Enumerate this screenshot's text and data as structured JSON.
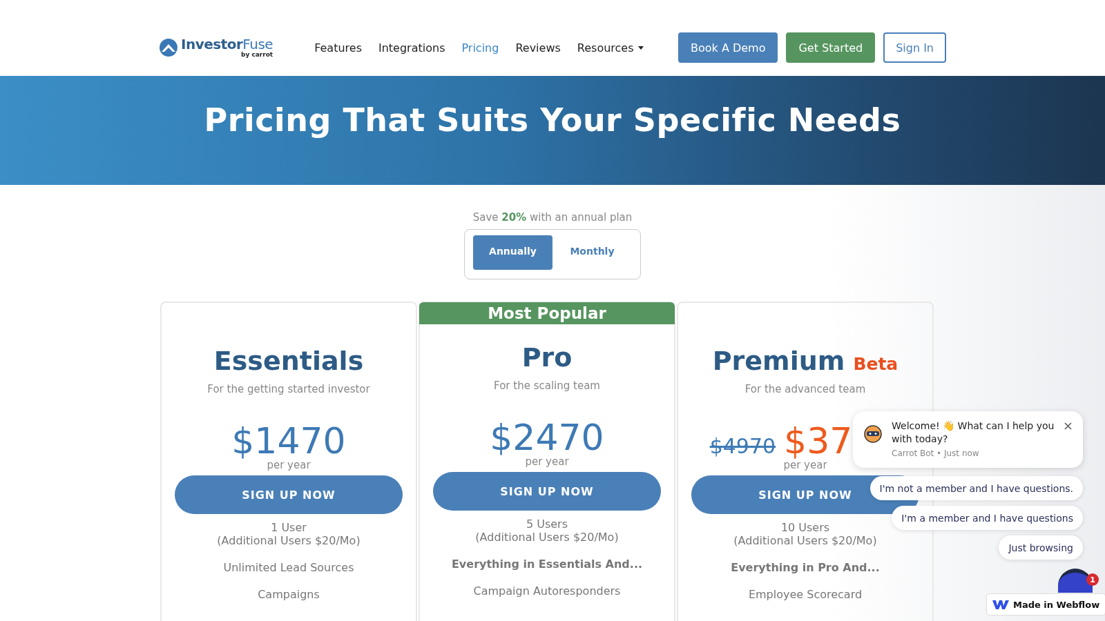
{
  "header": {
    "logo": {
      "name": "**Investor**Fuse",
      "tagline": "by carrot"
    },
    "nav": [
      {
        "label": "Features",
        "selected": false,
        "kind": "link"
      },
      {
        "label": "Integrations",
        "selected": false,
        "kind": "link"
      },
      {
        "label": "Pricing",
        "selected": true,
        "kind": "link"
      },
      {
        "label": "Reviews",
        "selected": false,
        "kind": "link"
      },
      {
        "label": "Resources",
        "selected": false,
        "kind": "dropdown"
      }
    ],
    "buttons": [
      {
        "label": "Book A Demo",
        "kind": "primary"
      },
      {
        "label": "Get Started",
        "kind": "success"
      },
      {
        "label": "Sign In",
        "kind": "outline"
      }
    ]
  },
  "hero": {
    "title": "Pricing That Suits Your Specific Needs"
  },
  "billing": {
    "note": "Save **20%** with an annual plan",
    "options": [
      {
        "label": "Annually",
        "selected": true
      },
      {
        "label": "Monthly",
        "selected": false
      }
    ]
  },
  "plans": [
    {
      "name": "Essentials",
      "popular": false,
      "subtitle": "For the getting started investor",
      "price": "$1470",
      "period": "per year",
      "cta": "SIGN UP NOW",
      "users": "1 User",
      "users_note": "(Additional Users $20/Mo)",
      "features": [
        {
          "text": "Unlimited Lead Sources",
          "bold": false
        },
        {
          "text": "Campaigns",
          "bold": false
        }
      ]
    },
    {
      "name": "Pro",
      "popular": true,
      "popular_label": "Most Popular",
      "subtitle": "For the scaling team",
      "price": "$2470",
      "period": "per year",
      "cta": "SIGN UP NOW",
      "users": "5 Users",
      "users_note": "(Additional Users $20/Mo)",
      "features": [
        {
          "text": "Everything in Essentials And...",
          "bold": true
        },
        {
          "text": "Campaign Autoresponders",
          "bold": false
        }
      ]
    },
    {
      "name": "Premium",
      "badge": "Beta",
      "popular": false,
      "subtitle": "For the advanced team",
      "old_price": "$4970",
      "price": "$37",
      "period": "per year",
      "cta": "SIGN UP NOW",
      "users": "10 Users",
      "users_note": "(Additional Users $20/Mo)",
      "features": [
        {
          "text": "Everything in Pro And...",
          "bold": true
        },
        {
          "text": "Employee Scorecard",
          "bold": false
        }
      ]
    }
  ],
  "chat": {
    "message": "Welcome! 👋 What can I help you with today?",
    "meta": "Carrot Bot • Just now",
    "replies": [
      "I'm not a member and I have questions.",
      "I'm a member and I have questions",
      "Just browsing"
    ],
    "unread": "1"
  },
  "webflow_badge": {
    "label": "Made in Webflow"
  }
}
